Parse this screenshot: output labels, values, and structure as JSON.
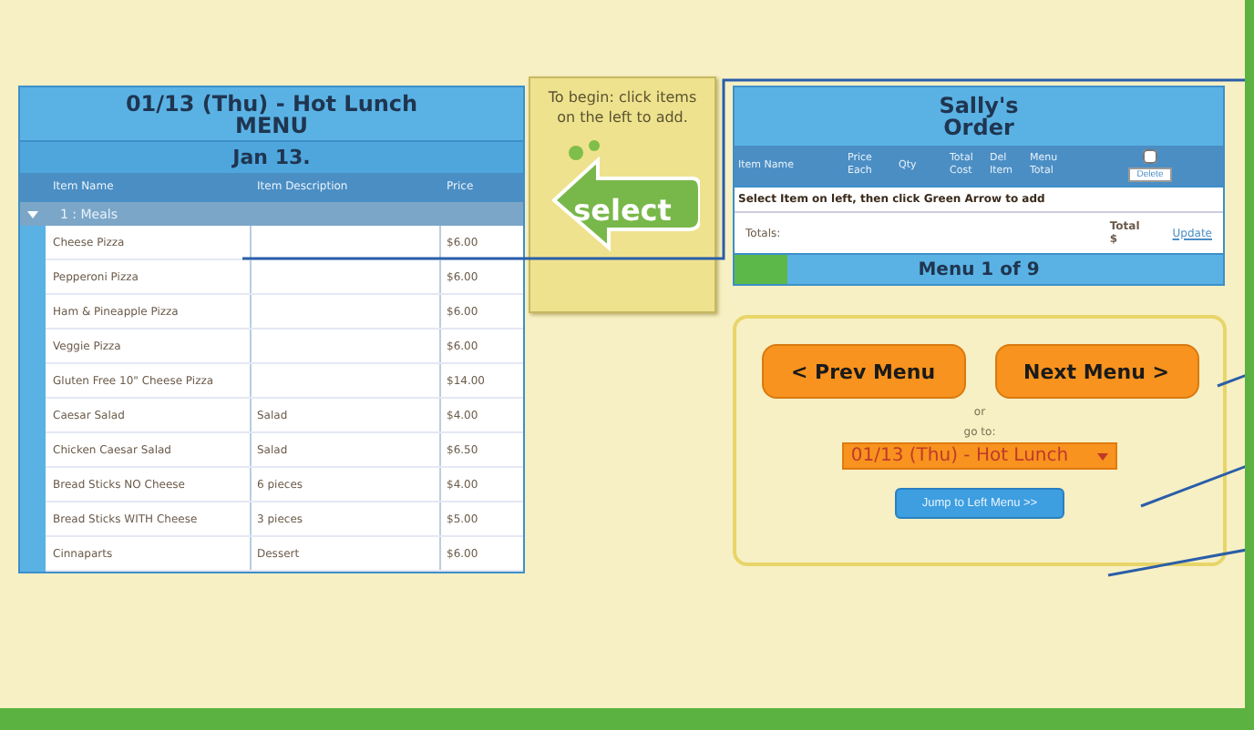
{
  "menu": {
    "title": "01/13 (Thu) - Hot Lunch",
    "subtitle": "MENU",
    "date": "Jan 13.",
    "columns": [
      "Item Name",
      "Item Description",
      "Price"
    ],
    "groups": [
      {
        "label": "1 : Meals",
        "expanded": true,
        "rows": [
          {
            "name": "Cheese Pizza",
            "description": "",
            "price": "$6.00"
          },
          {
            "name": "Pepperoni Pizza",
            "description": "",
            "price": "$6.00"
          },
          {
            "name": "Ham & Pineapple Pizza",
            "description": "",
            "price": "$6.00"
          },
          {
            "name": "Veggie Pizza",
            "description": "",
            "price": "$6.00"
          },
          {
            "name": "Gluten Free 10\" Cheese Pizza",
            "description": "",
            "price": "$14.00"
          },
          {
            "name": "Caesar Salad",
            "description": "Salad",
            "price": "$4.00"
          },
          {
            "name": "Chicken Caesar Salad",
            "description": "Salad",
            "price": "$6.50"
          },
          {
            "name": "Bread Sticks NO Cheese",
            "description": "6 pieces",
            "price": "$4.00"
          },
          {
            "name": "Bread Sticks WITH Cheese",
            "description": "3 pieces",
            "price": "$5.00"
          },
          {
            "name": "Cinnaparts",
            "description": "Dessert",
            "price": "$6.00"
          }
        ]
      }
    ]
  },
  "hint": {
    "text": "To begin: click items on the left to add.",
    "button": "select"
  },
  "order": {
    "title": "Sally's",
    "subtitle": "Order",
    "columns": [
      "Item Name",
      "Price Each",
      "Qty",
      "Total Cost",
      "Del Item",
      "Menu Total"
    ],
    "select_all": {
      "checked": false
    },
    "header_button": "Delete",
    "message": "Select Item on left, then click Green Arrow to add",
    "totals": {
      "label": "Totals:",
      "total_label": "Total",
      "total_value": "$",
      "link": "Update"
    },
    "progress": {
      "level": 0.11,
      "label": "Menu 1 of 9"
    }
  },
  "nav": {
    "prev": "< Prev Menu",
    "next": "Next Menu >",
    "or": "or",
    "goto": "go to:",
    "dropdown": "01/13 (Thu) - Hot Lunch",
    "jump": "Jump to Left Menu >>"
  }
}
